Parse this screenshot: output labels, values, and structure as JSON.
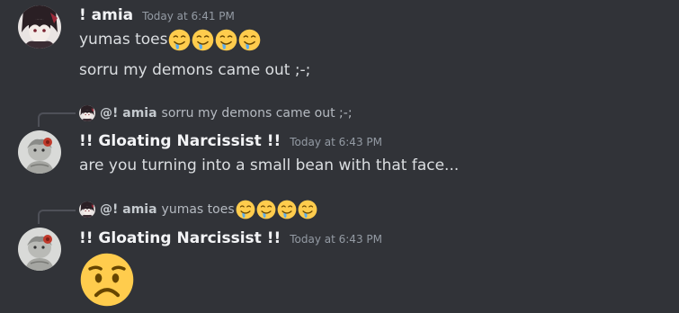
{
  "messages": [
    {
      "username": "! amia",
      "timestamp": "Today at 6:41 PM",
      "lines": [
        "yumas toes",
        "sorru my demons came out ;-;"
      ],
      "line1_emoji": [
        "drooling-face-icon",
        "drooling-face-icon",
        "drooling-face-icon",
        "drooling-face-icon"
      ]
    },
    {
      "reply": {
        "mention": "@! amia",
        "text": "sorru my demons came out ;-;"
      },
      "username": "!! Gloating Narcissist !!",
      "timestamp": "Today at 6:43 PM",
      "text": "are you turning into a small bean with that face..."
    },
    {
      "reply": {
        "mention": "@! amia",
        "text": "yumas toes",
        "emoji": [
          "drooling-face-icon",
          "drooling-face-icon",
          "drooling-face-icon",
          "drooling-face-icon"
        ]
      },
      "username": "!! Gloating Narcissist !!",
      "timestamp": "Today at 6:43 PM",
      "emoji": "worried-face-icon"
    }
  ],
  "colors": {
    "background": "#313338",
    "username": "#f2f3f5",
    "text": "#dbdee1",
    "timestamp": "#949ba4",
    "reply_spine": "#4e5058",
    "emoji_yellow": "#ffcc4d"
  }
}
